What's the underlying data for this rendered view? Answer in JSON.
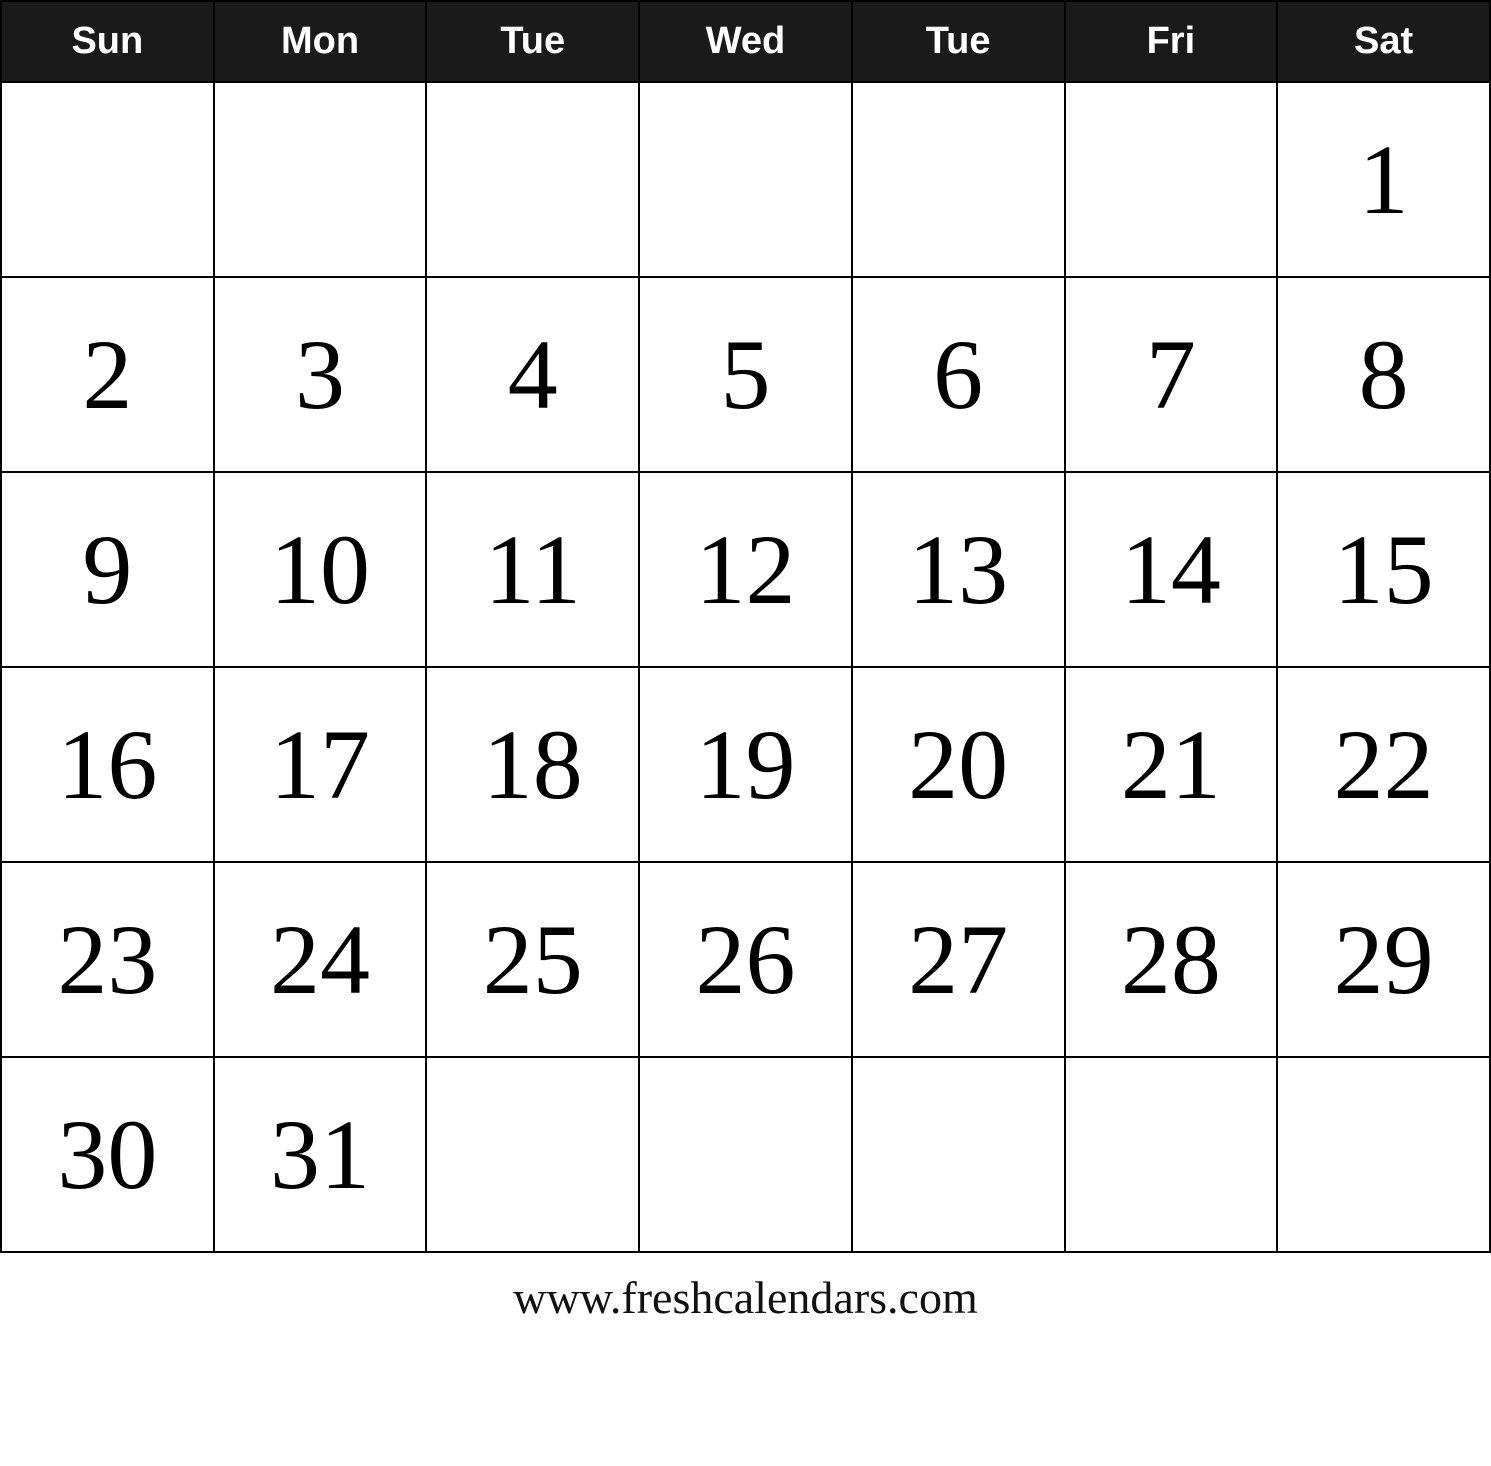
{
  "calendar": {
    "headers": [
      "Sun",
      "Mon",
      "Tue",
      "Wed",
      "Tue",
      "Fri",
      "Sat"
    ],
    "weeks": [
      [
        null,
        null,
        null,
        null,
        null,
        null,
        1
      ],
      [
        2,
        3,
        4,
        5,
        6,
        7,
        8
      ],
      [
        9,
        10,
        11,
        12,
        13,
        14,
        15
      ],
      [
        16,
        17,
        18,
        19,
        20,
        21,
        22
      ],
      [
        23,
        24,
        25,
        26,
        27,
        28,
        29
      ],
      [
        30,
        31,
        null,
        null,
        null,
        null,
        null
      ]
    ]
  },
  "footer": {
    "url": "www.freshcalendars.com"
  }
}
